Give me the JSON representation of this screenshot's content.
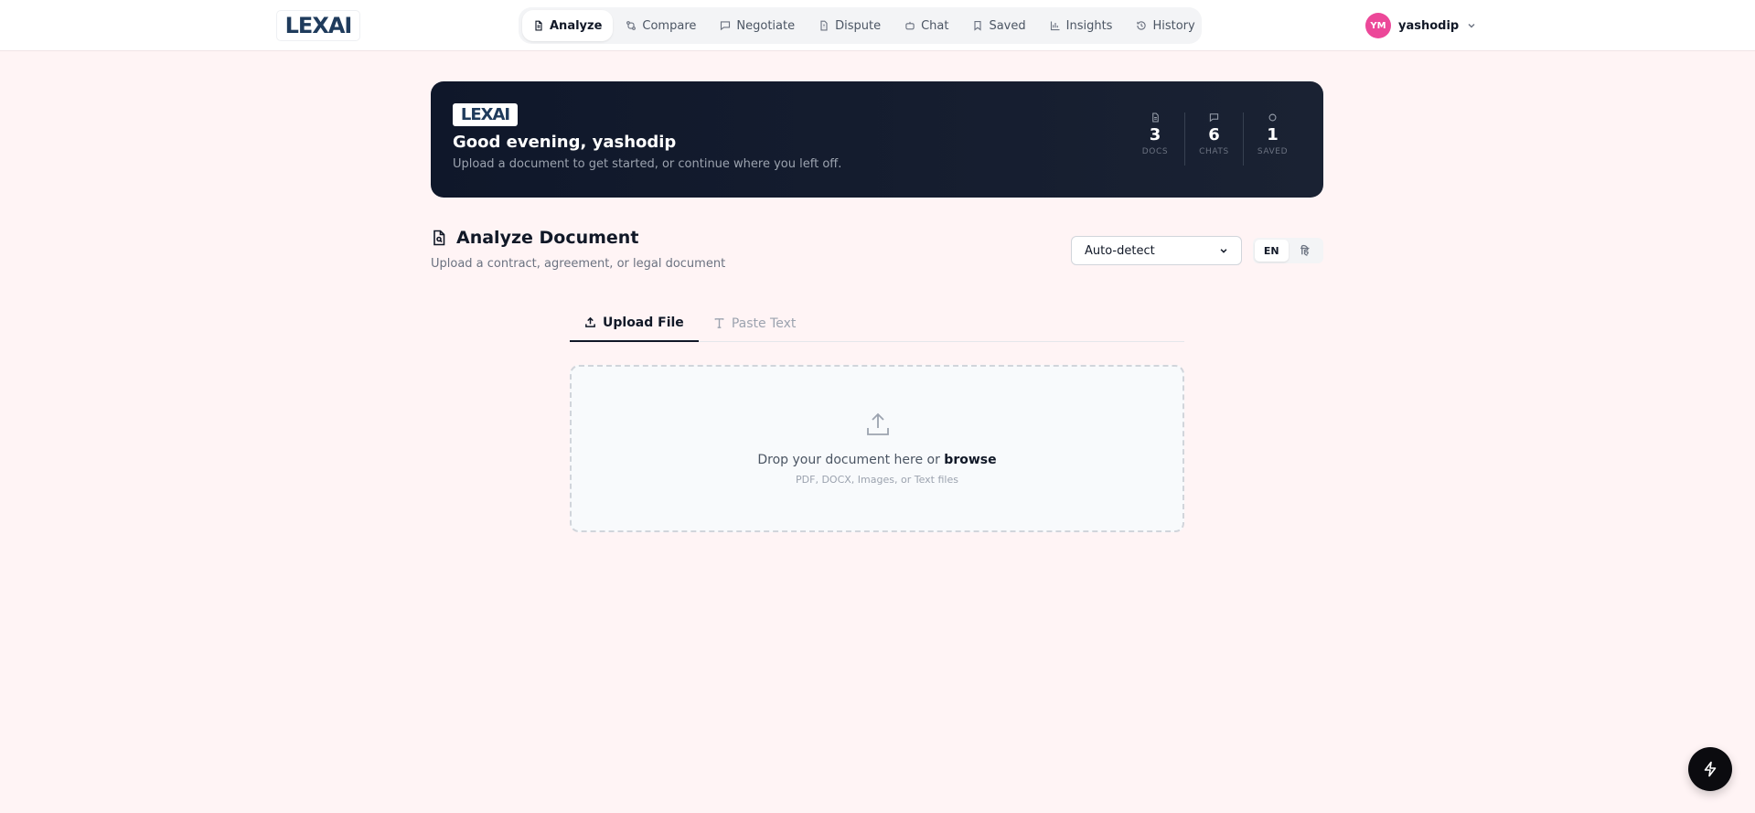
{
  "brand": {
    "logo_text": "LEXAI"
  },
  "nav": {
    "items": [
      {
        "label": "Analyze",
        "icon": "document-icon",
        "active": true
      },
      {
        "label": "Compare",
        "icon": "compare-icon"
      },
      {
        "label": "Negotiate",
        "icon": "message-icon"
      },
      {
        "label": "Dispute",
        "icon": "alert-document-icon"
      },
      {
        "label": "Chat",
        "icon": "bot-icon"
      },
      {
        "label": "Saved",
        "icon": "bookmark-icon"
      },
      {
        "label": "Insights",
        "icon": "bar-chart-icon"
      },
      {
        "label": "History",
        "icon": "history-icon"
      }
    ]
  },
  "user": {
    "initials": "YM",
    "name": "yashodip",
    "avatar_color": "#ec4899"
  },
  "hero": {
    "greeting": "Good evening, yashodip",
    "subtitle": "Upload a document to get started, or continue where you left off.",
    "stats": [
      {
        "value": "3",
        "label": "DOCS",
        "icon": "document-icon"
      },
      {
        "value": "6",
        "label": "CHATS",
        "icon": "chat-icon"
      },
      {
        "value": "1",
        "label": "SAVED",
        "icon": "circle-icon"
      }
    ]
  },
  "analyze": {
    "title": "Analyze Document",
    "subtitle": "Upload a contract, agreement, or legal document",
    "language_select": "Auto-detect",
    "lang_toggle": {
      "en": "EN",
      "other": "हि"
    }
  },
  "tabs": [
    {
      "label": "Upload File",
      "active": true
    },
    {
      "label": "Paste Text",
      "active": false
    }
  ],
  "dropzone": {
    "text": "Drop your document here or",
    "browse": "browse",
    "hint": "PDF, DOCX, Images, or Text files"
  }
}
